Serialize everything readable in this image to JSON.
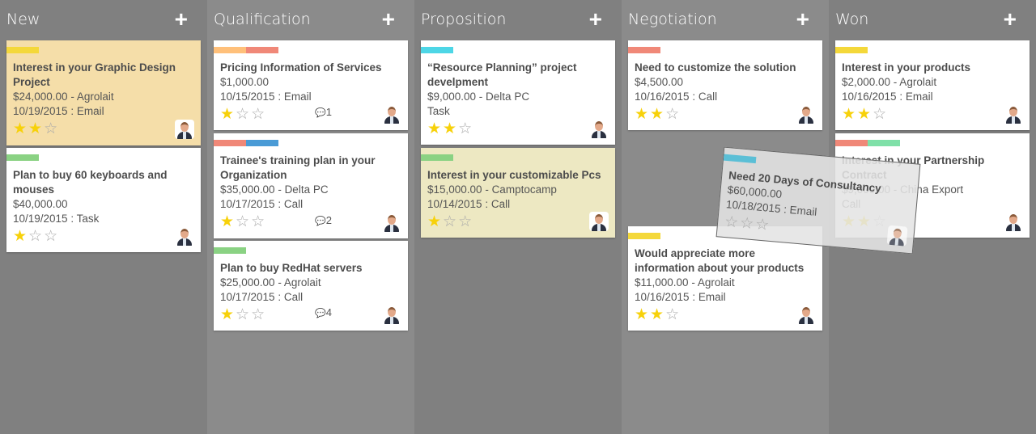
{
  "colors": {
    "star": "#f7d10a",
    "yellow": "#f4d83a",
    "orange": "#ffc07a",
    "salmon": "#f08878",
    "blue": "#4a9bd6",
    "cyan": "#4dd6e6",
    "green": "#8ad283",
    "mint": "#7fe0a8"
  },
  "add_icon": "+",
  "columns": [
    {
      "title": "New",
      "bg": "#808080",
      "cards": [
        {
          "title": "Interest in your Graphic Design Project",
          "lines": [
            "$24,000.00 - Agrolait",
            "10/19/2015 : Email"
          ],
          "tags": [
            "#f4d83a"
          ],
          "stars": 2,
          "bg": "#f5dea9"
        },
        {
          "title": "Plan to buy 60 keyboards and mouses",
          "lines": [
            "$40,000.00",
            "10/19/2015 : Task"
          ],
          "tags": [
            "#8ad283"
          ],
          "stars": 1
        }
      ]
    },
    {
      "title": "Qualification",
      "bg": "#8b8b8b",
      "cards": [
        {
          "title": "Pricing Information of Services",
          "lines": [
            "$1,000.00",
            "10/15/2015 : Email"
          ],
          "tags": [
            "#ffc07a",
            "#f08878"
          ],
          "stars": 1,
          "comments": "1"
        },
        {
          "title": "Trainee's training plan in your Organization",
          "lines": [
            "$35,000.00 - Delta PC",
            "10/17/2015 : Call"
          ],
          "tags": [
            "#f08878",
            "#4a9bd6"
          ],
          "stars": 1,
          "comments": "2"
        },
        {
          "title": "Plan to buy RedHat servers",
          "lines": [
            "$25,000.00 - Agrolait",
            "10/17/2015 : Call"
          ],
          "tags": [
            "#8ad283"
          ],
          "stars": 1,
          "comments": "4"
        }
      ]
    },
    {
      "title": "Proposition",
      "bg": "#808080",
      "cards": [
        {
          "title": "“Resource Planning” project develpment",
          "lines": [
            "$9,000.00 - Delta PC",
            "Task"
          ],
          "tags": [
            "#4dd6e6"
          ],
          "stars": 2
        },
        {
          "title": "Interest in your customizable Pcs",
          "lines": [
            "$15,000.00 - Camptocamp",
            "10/14/2015 : Call"
          ],
          "tags": [
            "#8ad283"
          ],
          "stars": 1,
          "bg": "#ede8c2"
        }
      ]
    },
    {
      "title": "Negotiation",
      "bg": "#8b8b8b",
      "cards": [
        {
          "title": "Need to customize the solution",
          "lines": [
            "$4,500.00",
            "10/16/2015 : Call"
          ],
          "tags": [
            "#f08878"
          ],
          "stars": 2
        },
        {
          "title": "Would appreciate more information about your products",
          "lines": [
            "$11,000.00 - Agrolait",
            "10/16/2015 : Email"
          ],
          "tags": [
            "#f4d83a"
          ],
          "stars": 2
        }
      ]
    },
    {
      "title": "Won",
      "bg": "#808080",
      "cards": [
        {
          "title": "Interest in your products",
          "lines": [
            "$2,000.00 - Agrolait",
            "10/16/2015 : Email"
          ],
          "tags": [
            "#f4d83a"
          ],
          "stars": 2
        },
        {
          "title": "Interest in your Partnership Contract",
          "lines": [
            "$9,000.00 - China Export",
            "Call"
          ],
          "tags": [
            "#f08878",
            "#7fe0a8"
          ],
          "stars": 2
        }
      ]
    }
  ],
  "dragged_card": {
    "title": "Need 20 Days of Consultancy",
    "lines": [
      "$60,000.00",
      "10/18/2015 : Email"
    ],
    "tags": [
      "#5bbfd6"
    ],
    "stars": 0
  }
}
